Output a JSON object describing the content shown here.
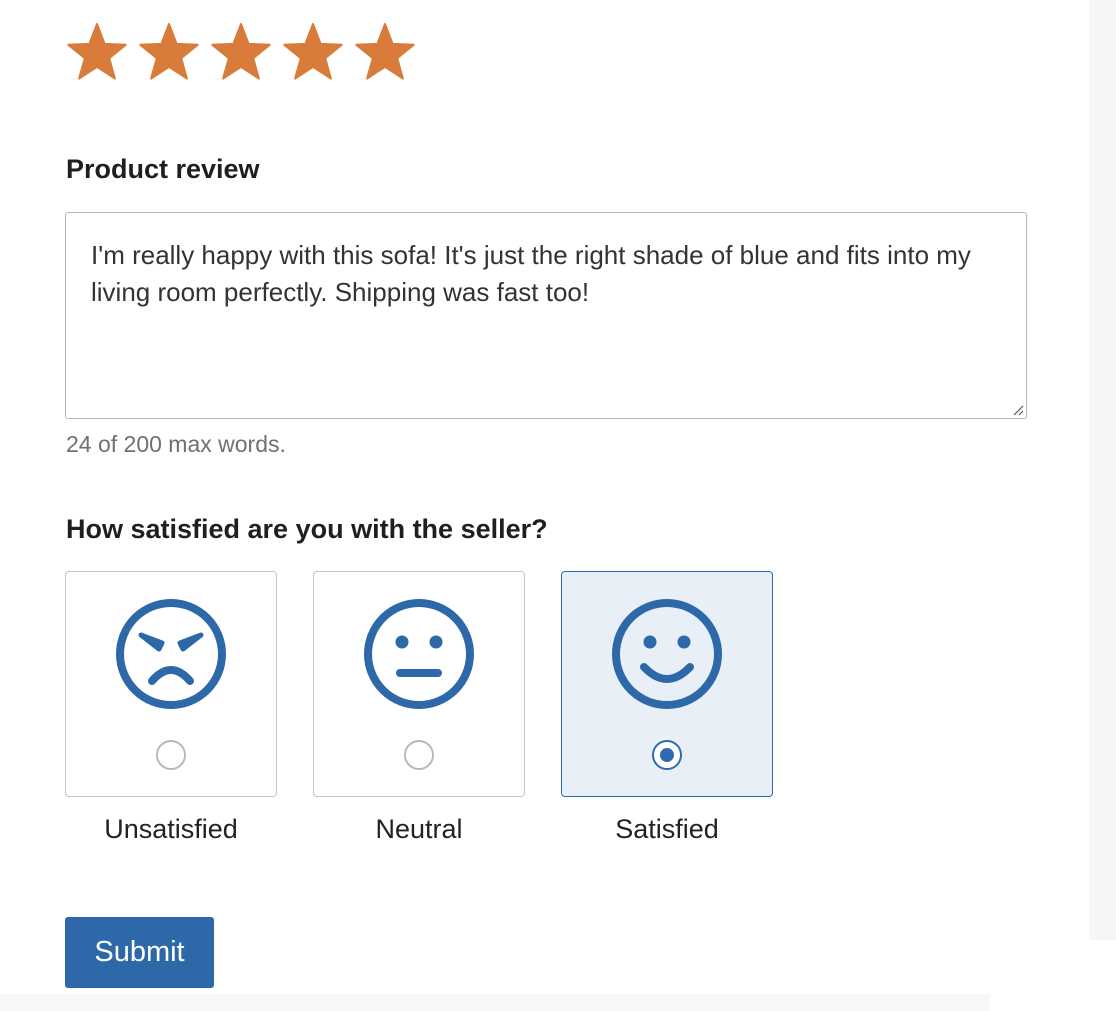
{
  "colors": {
    "star": "#d97b3a",
    "accent": "#2d68a9",
    "selected_bg": "#e8eff7",
    "border": "#c4c4c4"
  },
  "rating": {
    "value": 5,
    "max": 5,
    "icon": "star-icon"
  },
  "review": {
    "label": "Product review",
    "value": "I'm really happy with this sofa! It's just the right shade of blue and fits into my living room perfectly. Shipping was fast too!",
    "word_count_text": "24 of 200 max words."
  },
  "satisfaction": {
    "question": "How satisfied are you with the seller?",
    "selected": "Satisfied",
    "options": [
      {
        "label": "Unsatisfied",
        "icon": "angry-face-icon",
        "selected": false
      },
      {
        "label": "Neutral",
        "icon": "neutral-face-icon",
        "selected": false
      },
      {
        "label": "Satisfied",
        "icon": "smiling-face-icon",
        "selected": true
      }
    ]
  },
  "form": {
    "submit_label": "Submit"
  }
}
